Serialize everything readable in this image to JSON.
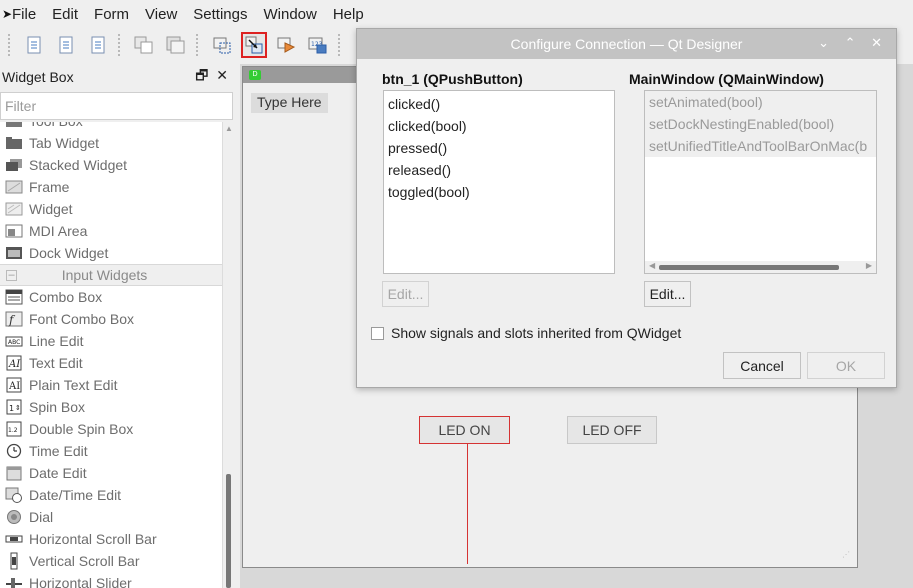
{
  "menubar": {
    "items": [
      "File",
      "Edit",
      "Form",
      "View",
      "Settings",
      "Window",
      "Help"
    ]
  },
  "toolbar": {
    "icons": [
      "edit-widgets-icon",
      "edit-buddies-icon",
      "edit-tab-order-icon",
      "layout-horizontal-icon",
      "layout-vertical-icon",
      "edit-signals-slots-icon",
      "edit-tab-order-icon",
      "adjust-size-icon"
    ]
  },
  "widget_box": {
    "title": "Widget Box",
    "title_controls": "🗗 ✕",
    "filter_placeholder": "Filter",
    "items_before": [
      {
        "label": "Tool Box",
        "icon": "toolbox-icon"
      },
      {
        "label": "Tab Widget",
        "icon": "tab-widget-icon"
      },
      {
        "label": "Stacked Widget",
        "icon": "stacked-widget-icon"
      },
      {
        "label": "Frame",
        "icon": "frame-icon"
      },
      {
        "label": "Widget",
        "icon": "widget-icon"
      },
      {
        "label": "MDI Area",
        "icon": "mdi-area-icon"
      },
      {
        "label": "Dock Widget",
        "icon": "dock-widget-icon"
      }
    ],
    "category": "Input Widgets",
    "items_after": [
      {
        "label": "Combo Box",
        "icon": "combo-box-icon"
      },
      {
        "label": "Font Combo Box",
        "icon": "font-combo-box-icon"
      },
      {
        "label": "Line Edit",
        "icon": "line-edit-icon"
      },
      {
        "label": "Text Edit",
        "icon": "text-edit-icon"
      },
      {
        "label": "Plain Text Edit",
        "icon": "plain-text-edit-icon"
      },
      {
        "label": "Spin Box",
        "icon": "spin-box-icon"
      },
      {
        "label": "Double Spin Box",
        "icon": "double-spin-box-icon"
      },
      {
        "label": "Time Edit",
        "icon": "time-edit-icon"
      },
      {
        "label": "Date Edit",
        "icon": "date-edit-icon"
      },
      {
        "label": "Date/Time Edit",
        "icon": "date-time-edit-icon"
      },
      {
        "label": "Dial",
        "icon": "dial-icon"
      },
      {
        "label": "Horizontal Scroll Bar",
        "icon": "horizontal-scroll-bar-icon"
      },
      {
        "label": "Vertical Scroll Bar",
        "icon": "vertical-scroll-bar-icon"
      },
      {
        "label": "Horizontal Slider",
        "icon": "horizontal-slider-icon"
      }
    ]
  },
  "form": {
    "type_here": "Type Here",
    "led_on": "LED ON",
    "led_off": "LED OFF"
  },
  "dialog": {
    "title": "Configure Connection — Qt Designer",
    "controls": "⌄ ⌃ ✕",
    "sender_label": "btn_1 (QPushButton)",
    "receiver_label": "MainWindow (QMainWindow)",
    "signals": [
      "clicked()",
      "clicked(bool)",
      "pressed()",
      "released()",
      "toggled(bool)"
    ],
    "slots": [
      "setAnimated(bool)",
      "setDockNestingEnabled(bool)",
      "setUnifiedTitleAndToolBarOnMac(b"
    ],
    "edit_left": "Edit...",
    "edit_right": "Edit...",
    "checkbox_label": "Show signals and slots inherited from QWidget",
    "checkbox_checked": false,
    "cancel": "Cancel",
    "ok": "OK"
  }
}
